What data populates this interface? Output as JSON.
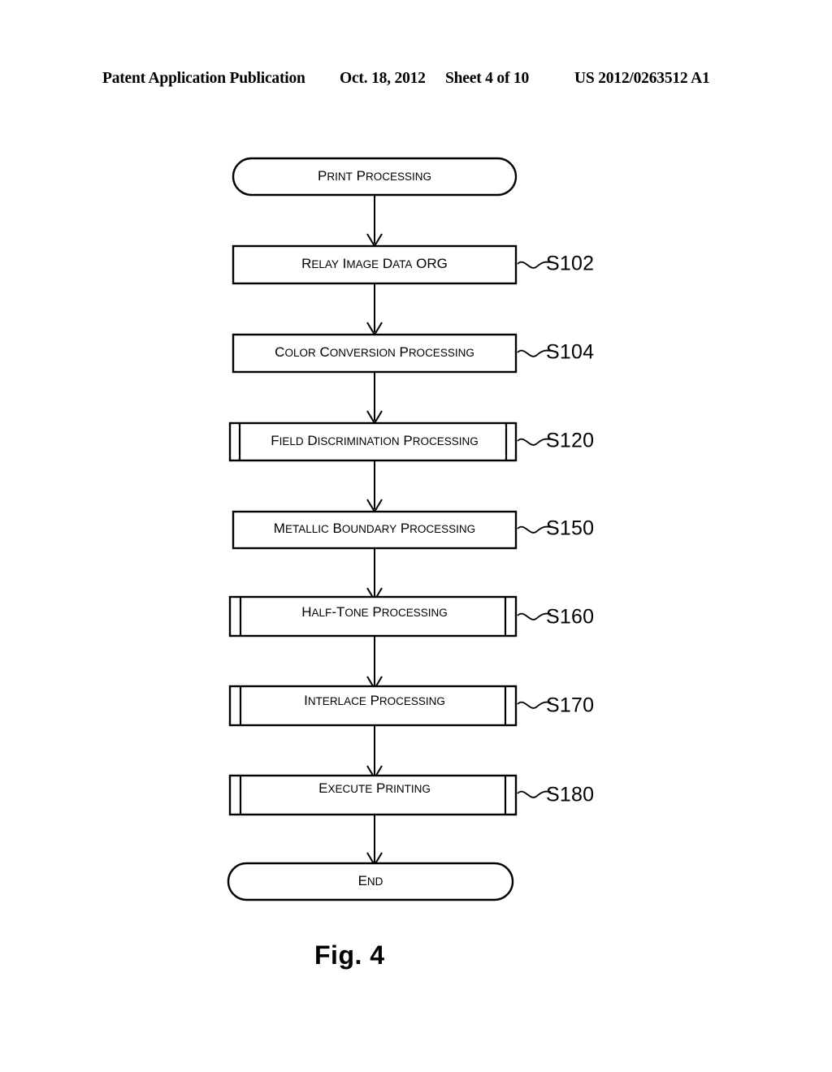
{
  "header": {
    "publication": "Patent Application Publication",
    "date": "Oct. 18, 2012",
    "sheet": "Sheet 4 of 10",
    "document_number": "US 2012/0263512 A1"
  },
  "figure": {
    "caption": "Fig. 4"
  },
  "flowchart": {
    "title": "Print Processing",
    "start_label": "Print Processing",
    "end_label": "End",
    "nodes": [
      {
        "id": "start",
        "label": "Print Processing",
        "shape": "terminator",
        "step": ""
      },
      {
        "id": "s102",
        "label": "Relay Image Data ORG",
        "shape": "process",
        "step": "S102"
      },
      {
        "id": "s104",
        "label": "Color Conversion Processing",
        "shape": "process",
        "step": "S104"
      },
      {
        "id": "s120",
        "label": "Field Discrimination Processing",
        "shape": "predefined-process",
        "step": "S120"
      },
      {
        "id": "s150",
        "label": "Metallic Boundary Processing",
        "shape": "process",
        "step": "S150"
      },
      {
        "id": "s160",
        "label": "Half-Tone Processing",
        "shape": "predefined-process",
        "step": "S160"
      },
      {
        "id": "s170",
        "label": "Interlace Processing",
        "shape": "predefined-process",
        "step": "S170"
      },
      {
        "id": "s180",
        "label": "Execute Printing",
        "shape": "predefined-process",
        "step": "S180"
      },
      {
        "id": "end",
        "label": "End",
        "shape": "terminator",
        "step": ""
      }
    ]
  }
}
